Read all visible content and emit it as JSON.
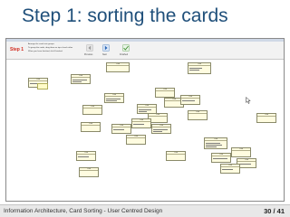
{
  "slide": {
    "title": "Step 1: sorting the cards"
  },
  "app": {
    "step_label": "Step 1",
    "instructions": [
      "Arrange the cards into groups",
      "To group the cards, drag them on top of each other",
      "When you have finished, click Finished"
    ],
    "toolbar": {
      "previous_label": "Previous",
      "next_label": "Next",
      "finished_label": "Finished"
    },
    "cards": [
      {
        "title": "Card"
      },
      {
        "title": "Card"
      },
      {
        "title": "Card"
      },
      {
        "title": "Card"
      },
      {
        "title": "Card"
      },
      {
        "title": "Card"
      },
      {
        "title": "Card"
      },
      {
        "title": "Card"
      },
      {
        "title": "Card"
      },
      {
        "title": "Card"
      },
      {
        "title": "Card"
      },
      {
        "title": "Card"
      },
      {
        "title": "Card"
      },
      {
        "title": "Card"
      },
      {
        "title": "Card"
      },
      {
        "title": "Card"
      },
      {
        "title": "Card"
      },
      {
        "title": "Card"
      },
      {
        "title": "Card"
      },
      {
        "title": "Card"
      },
      {
        "title": "Card"
      },
      {
        "title": "Card"
      },
      {
        "title": "Card"
      },
      {
        "title": "Card"
      },
      {
        "title": "Card"
      },
      {
        "title": "Card"
      }
    ]
  },
  "footer": {
    "text": "Information Architecture, Card Sorting - User Centred Design",
    "page": "30 / 41"
  },
  "colors": {
    "title": "#1f4f7a",
    "step_label": "#d22a1e",
    "card_fill": "#fffce0",
    "footer_bg": "#e8e8e8"
  }
}
